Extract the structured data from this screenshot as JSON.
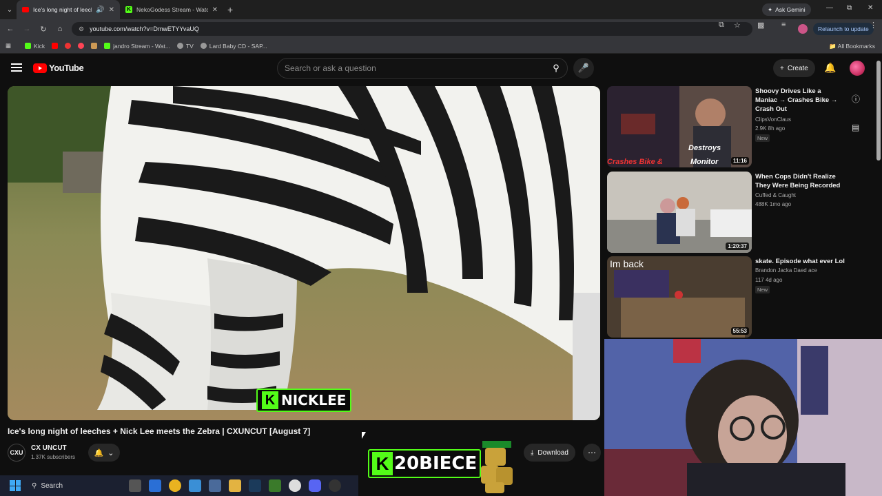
{
  "browser": {
    "tabs": [
      {
        "title": "Ice's long night of leeches",
        "active": true
      },
      {
        "title": "NekoGodess Stream - Watch Li",
        "active": false
      }
    ],
    "ask_gemini": "Ask Gemini",
    "url": "youtube.com/watch?v=DmwETYYvaUQ",
    "relaunch": "Relaunch to update",
    "bookmarks": [
      "Kick",
      "jandro Stream - Wat...",
      "TV",
      "Lard Baby CD - SAP..."
    ],
    "all_bookmarks": "All Bookmarks"
  },
  "youtube": {
    "logo": "YouTube",
    "search_placeholder": "Search or ask a question",
    "create": "Create"
  },
  "video": {
    "overlay_name": "NICKLEE",
    "title": "Ice's long night of leeches + Nick Lee meets the Zebra | CXUNCUT [August 7]",
    "channel_avatar": "CXU",
    "channel": "CX UNCUT",
    "subscribers": "1.37K subscribers",
    "download": "Download",
    "stream_overlay": "20BIECE"
  },
  "recommendations": [
    {
      "title": "Shoovy Drives Like a Maniac → Crashes Bike → Crash Out",
      "channel": "ClipsVonClaus",
      "meta": "2.9K  8h ago",
      "badge": "New",
      "duration": "11:16",
      "thumb_text": [
        "Destroys",
        "Crashes Bike &",
        "Monitor"
      ]
    },
    {
      "title": "When Cops Didn't Realize They Were Being Recorded",
      "channel": "Cuffed & Caught",
      "meta": "488K  1mo ago",
      "badge": "",
      "duration": "1:20:37",
      "thumb_text": []
    },
    {
      "title": "skate. Episode what ever Lol",
      "channel": "Brandon Jacka Daed ace",
      "meta": "117  4d ago",
      "badge": "New",
      "duration": "55:53",
      "thumb_text": [
        "Im back"
      ]
    }
  ],
  "taskbar": {
    "search": "Search"
  },
  "colors": {
    "kick_green": "#53fc18",
    "youtube_red": "#ff0000"
  }
}
